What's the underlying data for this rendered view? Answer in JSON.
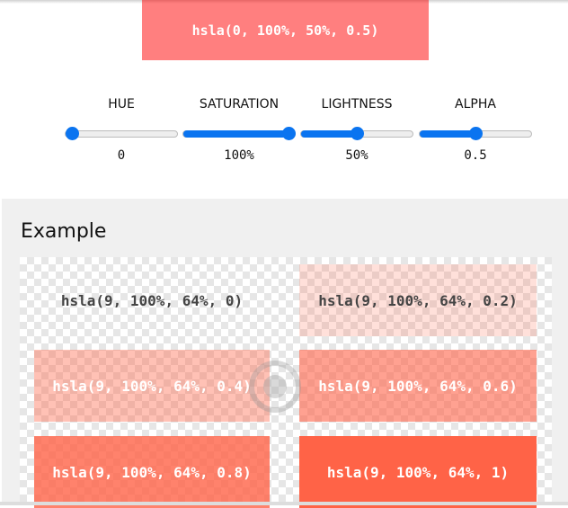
{
  "preview": {
    "text": "hsla(0, 100%, 50%, 0.5)",
    "color": "hsla(0, 100%, 50%, 0.5)"
  },
  "controls": [
    {
      "label": "HUE",
      "value": "0",
      "fraction": 0.0
    },
    {
      "label": "SATURATION",
      "value": "100%",
      "fraction": 1.0
    },
    {
      "label": "LIGHTNESS",
      "value": "50%",
      "fraction": 0.5
    },
    {
      "label": "ALPHA",
      "value": "0.5",
      "fraction": 0.5
    }
  ],
  "example": {
    "title": "Example",
    "swatches": [
      {
        "text": "hsla(9, 100%, 64%, 0)",
        "color": "hsla(9, 100%, 64%, 0)",
        "text_color": "#444"
      },
      {
        "text": "hsla(9, 100%, 64%, 0.2)",
        "color": "hsla(9, 100%, 64%, 0.2)",
        "text_color": "#444"
      },
      {
        "text": "hsla(9, 100%, 64%, 0.4)",
        "color": "hsla(9, 100%, 64%, 0.4)",
        "text_color": "#fff"
      },
      {
        "text": "hsla(9, 100%, 64%, 0.6)",
        "color": "hsla(9, 100%, 64%, 0.6)",
        "text_color": "#fff"
      },
      {
        "text": "hsla(9, 100%, 64%, 0.8)",
        "color": "hsla(9, 100%, 64%, 0.8)",
        "text_color": "#fff"
      },
      {
        "text": "hsla(9, 100%, 64%, 1)",
        "color": "hsla(9, 100%, 64%, 1)",
        "text_color": "#fff"
      }
    ]
  },
  "accent": "#0a74f0"
}
